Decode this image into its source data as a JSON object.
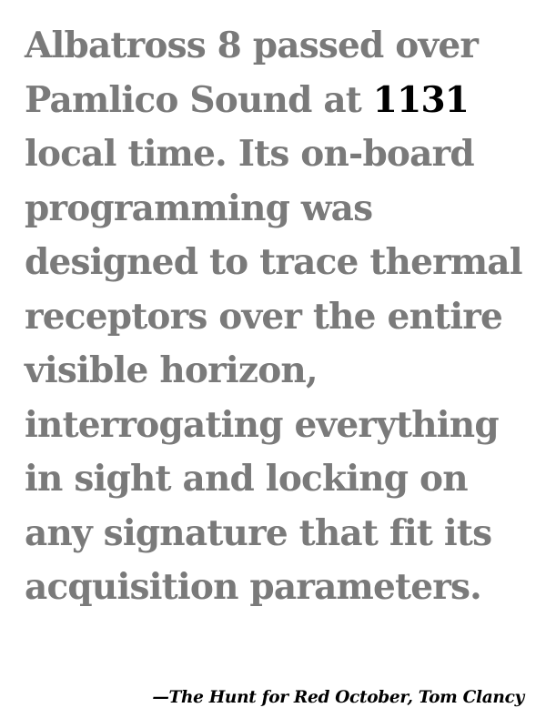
{
  "quote": {
    "lines": [
      {
        "text": "Albatross 8 passed over"
      },
      {
        "before": "Pamlico Sound at ",
        "highlight": "1131"
      },
      {
        "text": "local time. Its on-board"
      },
      {
        "text": "programming was"
      },
      {
        "text": "designed to trace thermal"
      },
      {
        "text": "receptors over the entire"
      },
      {
        "text": "visible horizon,"
      },
      {
        "text": "interrogating everything"
      },
      {
        "text": "in sight and locking on"
      },
      {
        "text": "any signature that fit its"
      },
      {
        "text": "acquisition parameters."
      }
    ]
  },
  "attribution": {
    "dash": "—",
    "title": "The Hunt for Red October",
    "separator": ", ",
    "author": "Tom Clancy"
  },
  "colors": {
    "quote_text": "#7a7a7a",
    "highlight": "#000000",
    "attribution": "#000000",
    "background": "#ffffff"
  }
}
